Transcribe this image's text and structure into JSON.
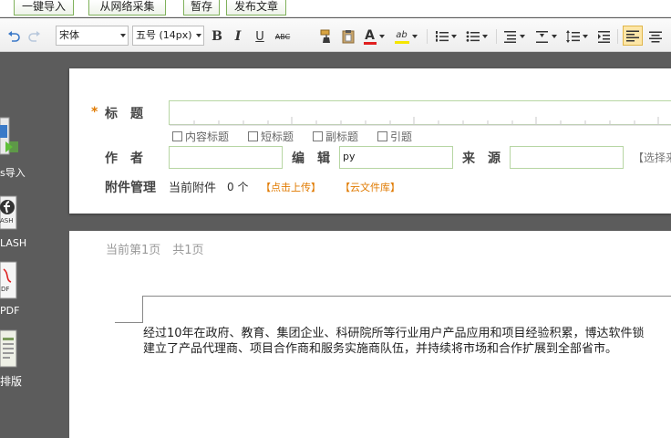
{
  "top_actions": {
    "import": "一键导入",
    "collect": "从网络采集",
    "save_draft": "暂存",
    "publish": "发布文章"
  },
  "toolbar": {
    "font_family": "宋体",
    "font_size": "五号 (14px)",
    "bold": "B",
    "italic": "I",
    "underline": "U",
    "strikethrough": "ABC",
    "font_color_glyph": "A",
    "highlight_glyph": "ab",
    "font_color_value": "#e02020",
    "highlight_color_value": "#f5e600",
    "accent": "#7fb15a"
  },
  "left_panel": {
    "items": [
      {
        "label": "s导入",
        "icon": "word-import-icon"
      },
      {
        "label": "LASH",
        "icon": "flash-icon"
      },
      {
        "label": "PDF",
        "icon": "pdf-icon"
      },
      {
        "label": "排版",
        "icon": "layout-icon"
      }
    ],
    "flash_glyph": "ASH",
    "pdf_glyph": "DF"
  },
  "form": {
    "required_mark": "*",
    "title_label": "标　题",
    "title_options": [
      "内容标题",
      "短标题",
      "副标题",
      "引题"
    ],
    "author_label": "作　者",
    "editor_label": "编　辑",
    "editor_value": "py",
    "source_label": "来　源",
    "source_select_hint": "【选择来",
    "attachment_label": "附件管理",
    "attachment_current": "当前附件",
    "attachment_count": "0 个",
    "upload_link": "【点击上传】",
    "cloud_link": "【云文件库】"
  },
  "document": {
    "page_info": "当前第1页　共1页",
    "paragraph_line1": "经过10年在政府、教育、集团企业、科研院所等行业用户产品应用和项目经验积累，博达软件锁",
    "paragraph_line2": "建立了产品代理商、项目合作商和服务实施商队伍，并持续将市场和合作扩展到全部省市。"
  }
}
